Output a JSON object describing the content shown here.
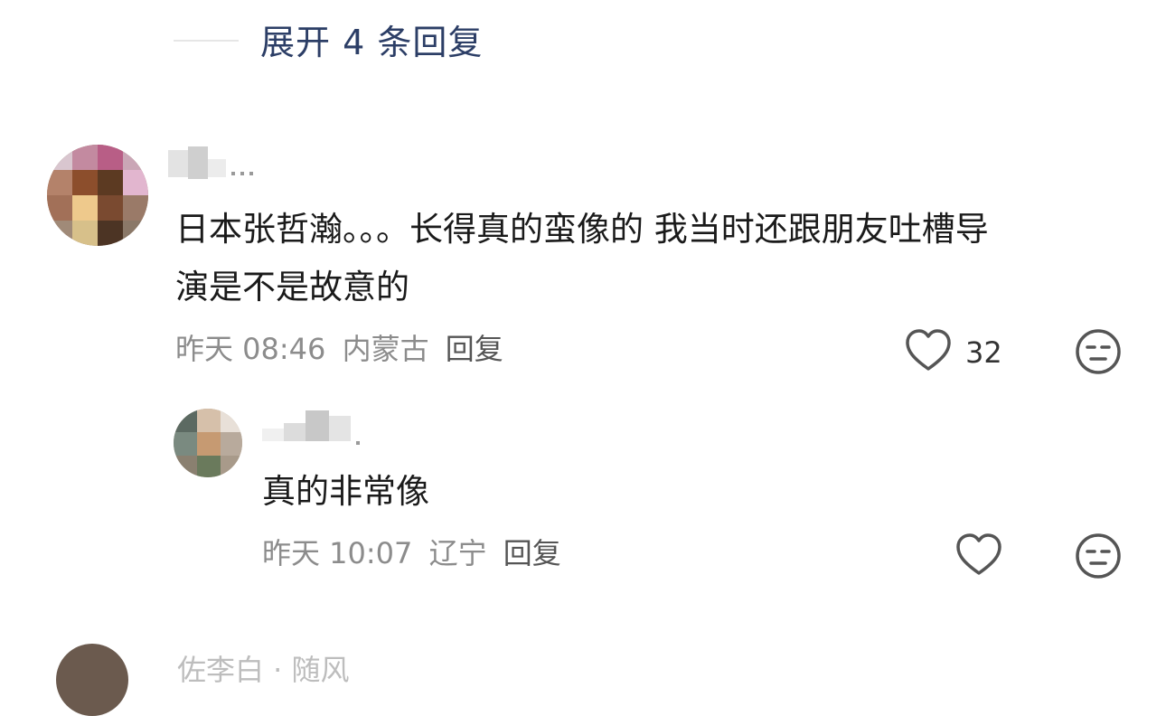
{
  "expand_replies": {
    "label": "展开 4 条回复"
  },
  "comments": [
    {
      "text_line1": "日本张哲瀚。。。长得真的蛮像的 我当时还跟朋友吐槽导",
      "text_line2": "演是不是故意的",
      "time": "昨天 08:46",
      "location": "内蒙古",
      "reply_label": "回复",
      "like_count": "32"
    },
    {
      "text_line1": "真的非常像",
      "time": "昨天 10:07",
      "location": "辽宁",
      "reply_label": "回复"
    }
  ],
  "next_comment": {
    "name": "佐李白 · 随风"
  },
  "colors": {
    "link": "#2c3e66",
    "text": "#1a1a1a",
    "meta": "#8c8c8c",
    "icon": "#555555"
  },
  "icons": [
    "heart-icon",
    "dislike-face-icon"
  ]
}
